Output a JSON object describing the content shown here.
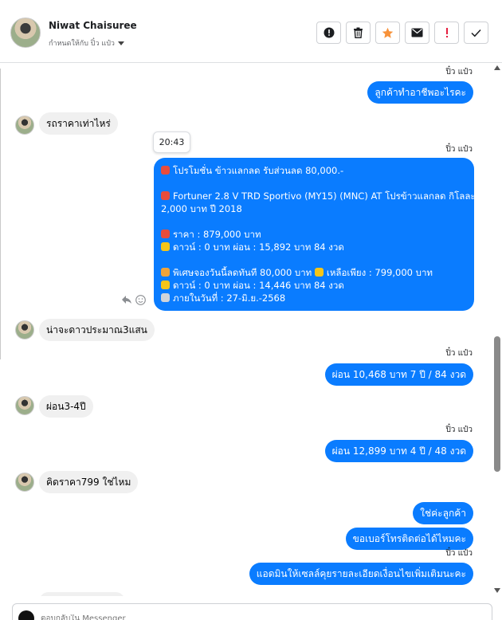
{
  "header": {
    "contact_name": "Niwat Chaisuree",
    "assigned_to": "กำหนดให้กับ ปิ๋ว แป๋ว",
    "tools": [
      {
        "name": "spam-report-button",
        "icon": "exclamation-circle-icon"
      },
      {
        "name": "delete-button",
        "icon": "trash-icon"
      },
      {
        "name": "star-button",
        "icon": "star-icon"
      },
      {
        "name": "mark-unread-button",
        "icon": "envelope-icon"
      },
      {
        "name": "follow-up-button",
        "icon": "exclamation-icon"
      },
      {
        "name": "mark-done-button",
        "icon": "check-icon"
      }
    ]
  },
  "thread": {
    "sender_label": "ปิ๋ว แป๋ว",
    "tooltip_time": "20:43",
    "messages": {
      "m1": "ลูกค้าทำอาชีพอะไรคะ",
      "m2": "รถราคาเท่าไหร่",
      "m4": "น่าจะดาวประมาณ3แสน",
      "m5": "ผ่อน 10,468 บาท  7 ปี / 84 งวด",
      "m6": "ผ่อน3-4ปี",
      "m7": "ผ่อน  12,899 บาท    4 ปี / 48 งวด",
      "m8": "คิดราคา799 ใช่ไหม",
      "m9": "ใช่ค่ะลูกค้า",
      "m10": "ขอเบอร์โทรติดต่อได้ไหมคะ",
      "m11": "แอดมินให้เซลล์คุยรายละเอียดเงื่อนไขเพิ่มเติมนะคะ"
    },
    "promo": {
      "line1": "โปรโมชั่น ข้าวแลกลด รับส่วนลด 80,000.-",
      "line2": "Fortuner 2.8 V TRD Sportivo (MY15) (MNC) AT โปรข้าวแลกลด กิโลละ",
      "line3": "2,000 บาท ปี 2018",
      "line4": "ราคา : 879,000 บาท",
      "line5": "ดาวน์ : 0 บาท ผ่อน : 15,892 บาท 84 งวด",
      "line6": "พิเศษจองวันนี้ลดทันที 80,000 บาท",
      "line6b": "เหลือเพียง : 799,000 บาท",
      "line7": "ดาวน์ : 0 บาท ผ่อน : 14,446 บาท 84 งวด",
      "line8": "ภายในวันที่ : 27-มิ.ย.-2568"
    }
  },
  "composer": {
    "placeholder": "ตอบกลับใน Messenger"
  },
  "colors": {
    "outgoing_bubble": "#0a7cff",
    "incoming_bubble": "#f0f0f0",
    "star": "#f7923a",
    "alert": "#e41e3f"
  }
}
